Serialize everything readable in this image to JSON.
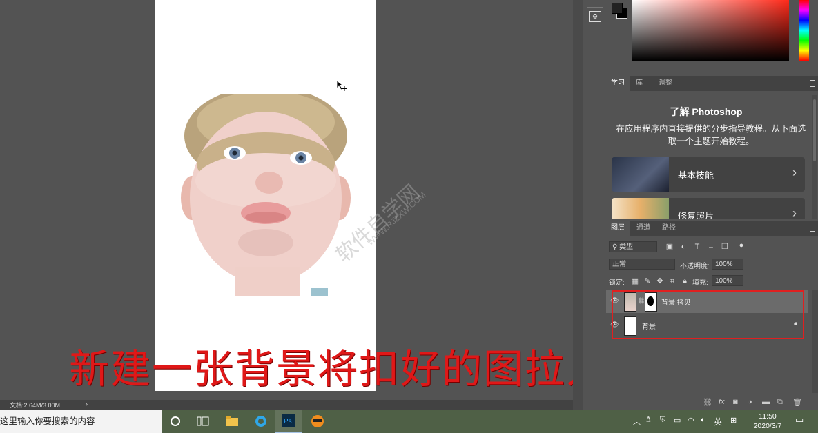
{
  "canvas": {
    "caption": "新建一张背景将扣好的图拉入",
    "watermark_main": "软件自学网",
    "watermark_sub": "WWW.RJZXW.COM"
  },
  "statusbar": {
    "doc_size": "文档:2.64M/3.00M",
    "arrow": "›"
  },
  "learn_panel": {
    "tabs": [
      "学习",
      "库",
      "调整"
    ],
    "active_tab": "学习",
    "title": "了解 Photoshop",
    "description": "在应用程序内直接提供的分步指导教程。从下面选取一个主题开始教程。",
    "cards": [
      {
        "label": "基本技能"
      },
      {
        "label": "修复照片"
      }
    ]
  },
  "layers_panel": {
    "tabs": [
      "图层",
      "通道",
      "路径"
    ],
    "active_tab": "图层",
    "filter_label": "类型",
    "blend_mode": "正常",
    "opacity_label": "不透明度:",
    "opacity_value": "100%",
    "lock_label": "锁定:",
    "fill_label": "填充:",
    "fill_value": "100%",
    "layers": [
      {
        "name": "背景 拷贝",
        "selected": true,
        "locked": false
      },
      {
        "name": "背景",
        "selected": false,
        "locked": true
      }
    ],
    "bottom_icons": [
      "link-icon",
      "fx-icon",
      "mask-icon",
      "adjustment-icon",
      "group-icon",
      "new-layer-icon",
      "trash-icon"
    ],
    "fx_label": "fx"
  },
  "taskbar": {
    "search_text": "这里输入你要搜索的内容",
    "ime": "英",
    "time": "11:50",
    "date": "2020/3/7"
  },
  "colors": {
    "accent_red": "#e02020",
    "caption_red": "#e01818"
  }
}
